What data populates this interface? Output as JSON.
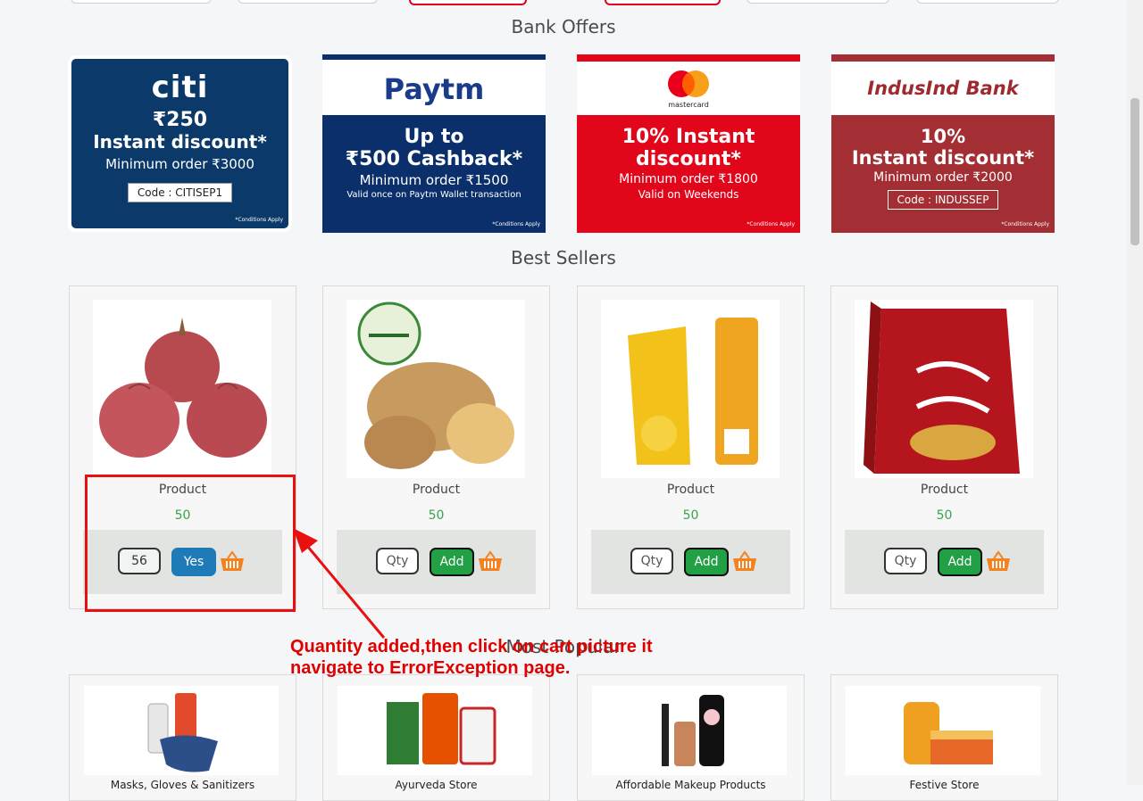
{
  "sections": {
    "bank_offers_title": "Bank Offers",
    "best_sellers_title": "Best Sellers",
    "most_popular_title": "Most Popular"
  },
  "bank_offers": [
    {
      "brand": "citi",
      "line1": "₹250",
      "line2": "Instant discount*",
      "line3": "Minimum order ₹3000",
      "code": "Code : CITISEP1",
      "cond": "*Conditions Apply",
      "color": "#0b3a6a"
    },
    {
      "brand": "Paytm",
      "line1": "Up to",
      "line2": "₹500 Cashback*",
      "line3": "Minimum order ₹1500",
      "line4": "Valid once on Paytm Wallet transaction",
      "cond": "*Conditions Apply",
      "color": "#0b2f6b"
    },
    {
      "brand": "mastercard",
      "line1": "10% Instant",
      "line2": "discount*",
      "line3": "Minimum order ₹1800",
      "line4": "Valid on Weekends",
      "cond": "*Conditions Apply",
      "color": "#e2061b"
    },
    {
      "brand": "IndusInd Bank",
      "line1": "10%",
      "line2": "Instant discount*",
      "line3": "Minimum order ₹2000",
      "code": "Code : INDUSSEP",
      "cond": "*Conditions Apply",
      "color": "#a32e34"
    }
  ],
  "best_sellers": [
    {
      "name": "Product",
      "price": "50",
      "qty_value": "56",
      "button": "Yes",
      "image": "onion"
    },
    {
      "name": "Product",
      "price": "50",
      "qty_placeholder": "Qty",
      "button": "Add",
      "image": "potato"
    },
    {
      "name": "Product",
      "price": "50",
      "qty_placeholder": "Qty",
      "button": "Add",
      "image": "fortune-oil"
    },
    {
      "name": "Product",
      "price": "50",
      "qty_placeholder": "Qty",
      "button": "Add",
      "image": "red-label-tea"
    }
  ],
  "most_popular": [
    {
      "label": "Masks, Gloves & Sanitizers"
    },
    {
      "label": "Ayurveda Store"
    },
    {
      "label": "Affordable Makeup Products"
    },
    {
      "label": "Festive Store"
    }
  ],
  "annotation": {
    "line1": "Quantity added,then click on cart picture it",
    "line2": "navigate to ErrorException page."
  },
  "colors": {
    "price": "#39a34a",
    "add_button": "#22a045",
    "yes_button": "#1f7ab8",
    "annotation": "#e81010"
  }
}
